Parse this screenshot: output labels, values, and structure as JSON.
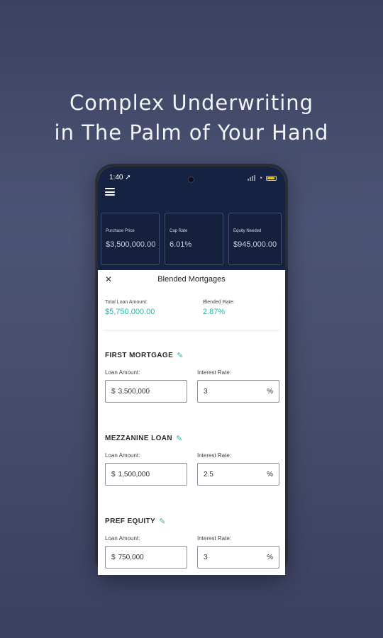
{
  "headline": [
    "Complex Underwriting",
    "in The Palm of Your Hand"
  ],
  "status_bar": {
    "time": "1:40 ➚"
  },
  "metrics": [
    {
      "label": "Purchase Price",
      "value": "$3,500,000.00"
    },
    {
      "label": "Cap Rate",
      "value": "6.01%"
    },
    {
      "label": "Equity Needed",
      "value": "$945,000.00"
    }
  ],
  "sheet": {
    "title": "Blended Mortgages",
    "close": "✕",
    "total_loan_label": "Total Loan Amount:",
    "total_loan_value": "$5,750,000.00",
    "blended_rate_label": "Blended Rate:",
    "blended_rate_value": "2.87%"
  },
  "loans": [
    {
      "title": "FIRST MORTGAGE",
      "amount_label": "Loan Amount:",
      "amount_prefix": "$",
      "amount": "3,500,000",
      "rate_label": "Interest Rate:",
      "rate": "3",
      "rate_suffix": "%"
    },
    {
      "title": "MEZZANINE LOAN",
      "amount_label": "Loan Amount:",
      "amount_prefix": "$",
      "amount": "1,500,000",
      "rate_label": "Interest Rate:",
      "rate": "2.5",
      "rate_suffix": "%"
    },
    {
      "title": "PREF EQUITY",
      "amount_label": "Loan Amount:",
      "amount_prefix": "$",
      "amount": "750,000",
      "rate_label": "Interest Rate:",
      "rate": "3",
      "rate_suffix": "%"
    }
  ],
  "colors": {
    "accent": "#2fb3a6",
    "navy": "#162241",
    "background": "#474e6c"
  },
  "icons": [
    "menu-icon",
    "close-icon",
    "pencil-icon",
    "wifi-icon",
    "battery-icon",
    "signal-icon"
  ]
}
